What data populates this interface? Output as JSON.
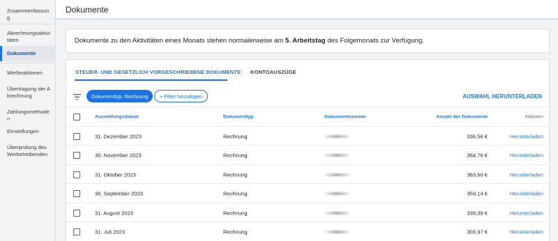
{
  "sidebar": {
    "items": [
      {
        "label": "Zusammenfassung"
      },
      {
        "label": "Abrechnungsaktivitäten"
      },
      {
        "label": "Dokumente",
        "active": true
      },
      {
        "label": "Werbeaktionen"
      },
      {
        "label": "Übertragung der Abrechnung"
      },
      {
        "label": "Zahlungsmethoden"
      },
      {
        "label": "Einstellungen"
      },
      {
        "label": "Überprüfung des Werbetreibenden"
      }
    ]
  },
  "header": {
    "title": "Dokumente"
  },
  "notice": {
    "text_before": "Dokumente zu den Aktivitäten eines Monats stehen normalerweise am ",
    "bold": "5. Arbeitstag",
    "text_after": " des Folgemonats zur Verfügung."
  },
  "tabs": [
    {
      "label": "STEUER- UND GESETZLICH VORGESCHRIEBENE DOKUMENTE",
      "active": true
    },
    {
      "label": "KONTOAUSZÜGE",
      "active": false
    }
  ],
  "filters": {
    "active_chip": "Dokumenttyp: Rechnung",
    "add_chip": "+ Filter hinzufügen",
    "filter_icon": "filter-icon"
  },
  "download_all_label": "AUSWAHL HERUNTERLADEN",
  "table": {
    "columns": [
      "Ausstellungsdatum",
      "Dokumenttyp",
      "Dokumentnummer",
      "Anzahl der Dokumente",
      "Aktionen"
    ],
    "rows": [
      {
        "date": "31. Dezember 2023",
        "type": "Rechnung",
        "amount": "336,56 €",
        "action": "Herunterladen"
      },
      {
        "date": "30. November 2023",
        "type": "Rechnung",
        "amount": "364,76 €",
        "action": "Herunterladen"
      },
      {
        "date": "31. Oktober 2023",
        "type": "Rechnung",
        "amount": "363,60 €",
        "action": "Herunterladen"
      },
      {
        "date": "30. September 2023",
        "type": "Rechnung",
        "amount": "359,14 €",
        "action": "Herunterladen"
      },
      {
        "date": "31. August 2023",
        "type": "Rechnung",
        "amount": "339,39 €",
        "action": "Herunterladen"
      },
      {
        "date": "31. Juli 2023",
        "type": "Rechnung",
        "amount": "303,97 €",
        "action": "Herunterladen"
      }
    ]
  },
  "colors": {
    "accent": "#1a73e8",
    "sidebar_bg": "#f1f3f4",
    "active_text": "#1a4fa8"
  }
}
